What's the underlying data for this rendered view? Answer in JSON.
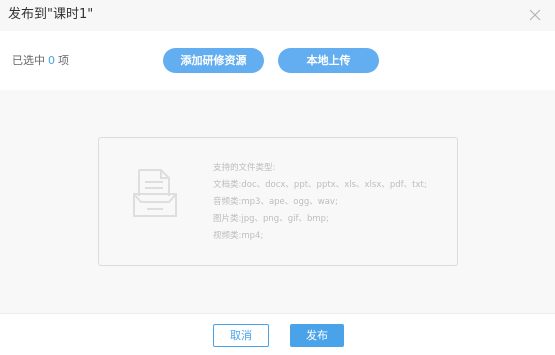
{
  "dialog": {
    "title": "发布到\"课时1\"",
    "close_icon": "close-icon"
  },
  "toolbar": {
    "selected_prefix": "已选中",
    "selected_count": "0",
    "selected_suffix": "项",
    "add_resource_label": "添加研修资源",
    "local_upload_label": "本地上传"
  },
  "dropzone": {
    "icon": "document-icon",
    "hint_title": "支持的文件类型:",
    "hint_lines": [
      "文档类:doc、docx、ppt、pptx、xls、xlsx、pdf、txt;",
      "音频类:mp3、ape、ogg、wav;",
      "图片类:jpg、png、gif、bmp;",
      "视频类:mp4;"
    ]
  },
  "footer": {
    "cancel_label": "取消",
    "publish_label": "发布"
  },
  "colors": {
    "accent": "#4aa3e8",
    "pill": "#63aef0",
    "hint_text": "#bdbdbd"
  }
}
